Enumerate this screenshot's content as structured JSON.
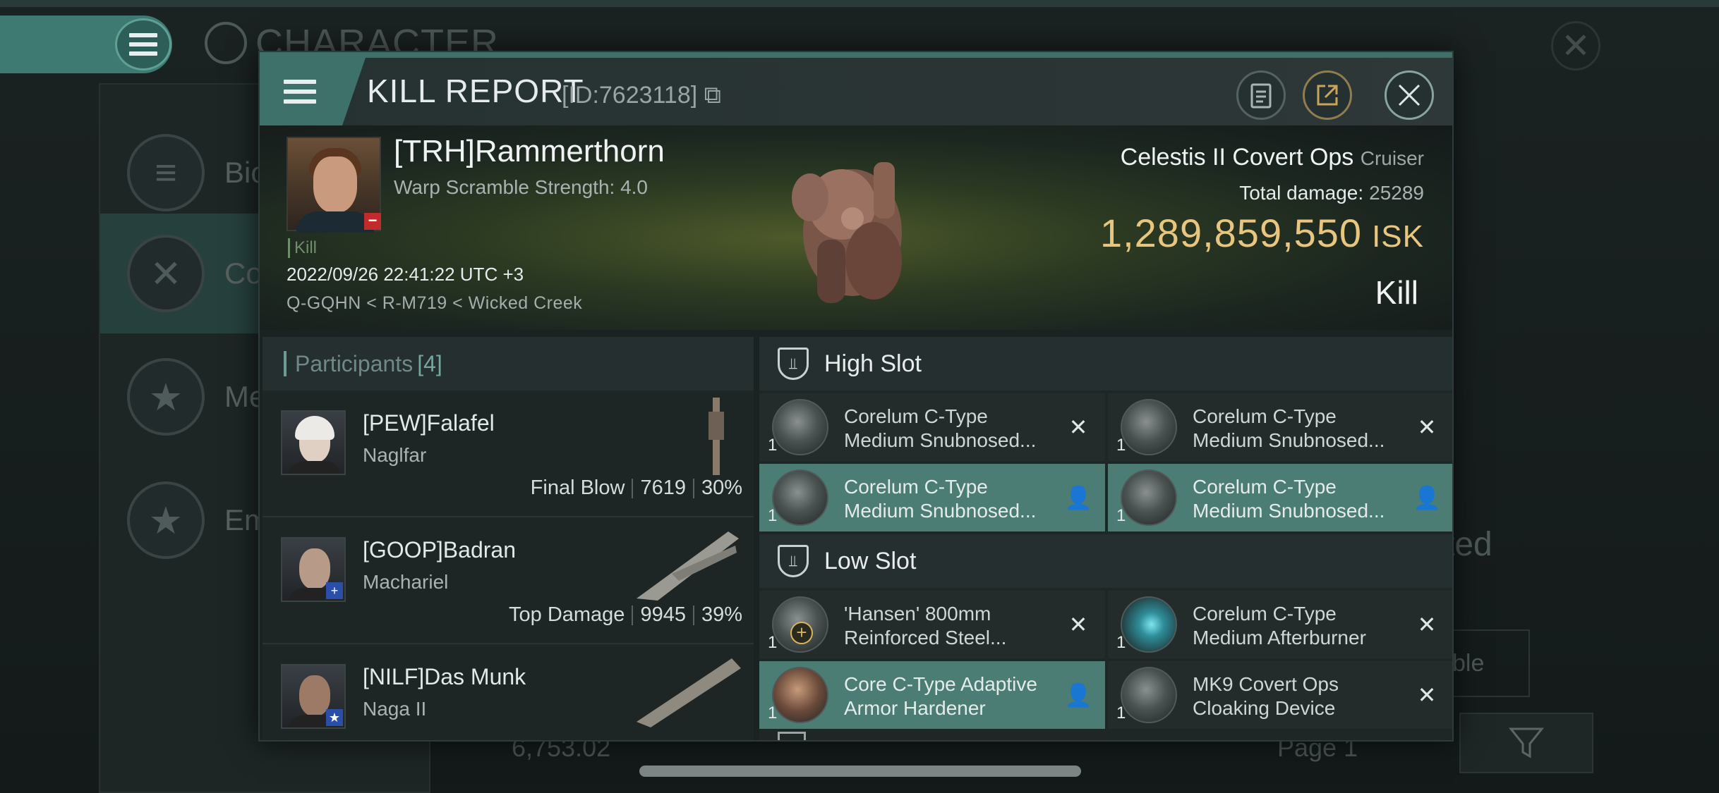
{
  "background": {
    "title": "CHARACTER",
    "side_items": [
      {
        "label": "Bio",
        "icon": "list-icon"
      },
      {
        "label": "Co",
        "icon": "crossed-swords-icon"
      },
      {
        "label": "Me",
        "icon": "medal-star-icon"
      },
      {
        "label": "Em",
        "icon": "emblem-star-icon"
      }
    ],
    "right_text": "ted",
    "right_button": "ble",
    "bottom_isk": "6,753.02",
    "page_label": "Page 1"
  },
  "header": {
    "title": "KILL REPORT",
    "id_text": "[ID:7623118]"
  },
  "victim": {
    "name": "[TRH]Rammerthorn",
    "subtitle": "Warp Scramble Strength: 4.0",
    "tag": "Kill",
    "datetime": "2022/09/26 22:41:22 UTC +3",
    "location": "Q-GQHN < R-M719 < Wicked Creek"
  },
  "ship": {
    "name": "Celestis II Covert Ops",
    "class": "Cruiser",
    "total_damage_label": "Total damage:",
    "total_damage": "25289",
    "isk_value": "1,289,859,550",
    "isk_unit": "ISK",
    "result": "Kill"
  },
  "participants": {
    "title": "Participants",
    "count": "[4]",
    "rows": [
      {
        "name": "[PEW]Falafel",
        "ship": "Naglfar",
        "tag": "Final Blow",
        "damage": "7619",
        "percent": "30%"
      },
      {
        "name": "[GOOP]Badran",
        "ship": "Machariel",
        "tag": "Top Damage",
        "damage": "9945",
        "percent": "39%"
      },
      {
        "name": "[NILF]Das Munk",
        "ship": "Naga II",
        "tag": "",
        "damage": "",
        "percent": ""
      }
    ]
  },
  "fitting": {
    "high_slot_title": "High Slot",
    "low_slot_title": "Low Slot",
    "high": [
      {
        "qty": "1",
        "name_line1": "Corelum C-Type",
        "name_line2": "Medium Snubnosed...",
        "status": "destroyed"
      },
      {
        "qty": "1",
        "name_line1": "Corelum C-Type",
        "name_line2": "Medium Snubnosed...",
        "status": "destroyed"
      },
      {
        "qty": "1",
        "name_line1": "Corelum C-Type",
        "name_line2": "Medium Snubnosed...",
        "status": "dropped"
      },
      {
        "qty": "1",
        "name_line1": "Corelum C-Type",
        "name_line2": "Medium Snubnosed...",
        "status": "dropped"
      }
    ],
    "low": [
      {
        "qty": "1",
        "name_line1": "'Hansen' 800mm",
        "name_line2": "Reinforced Steel...",
        "status": "destroyed"
      },
      {
        "qty": "1",
        "name_line1": "Corelum C-Type",
        "name_line2": "Medium Afterburner",
        "status": "destroyed"
      },
      {
        "qty": "1",
        "name_line1": "Core C-Type Adaptive",
        "name_line2": "Armor Hardener",
        "status": "dropped"
      },
      {
        "qty": "1",
        "name_line1": "MK9 Covert Ops",
        "name_line2": "Cloaking Device",
        "status": "destroyed"
      }
    ]
  },
  "colors": {
    "accent": "#3d7169",
    "isk": "#e9c67f",
    "dropped_bg": "#4b7d75",
    "destroyed_bg": "#232b2b"
  }
}
